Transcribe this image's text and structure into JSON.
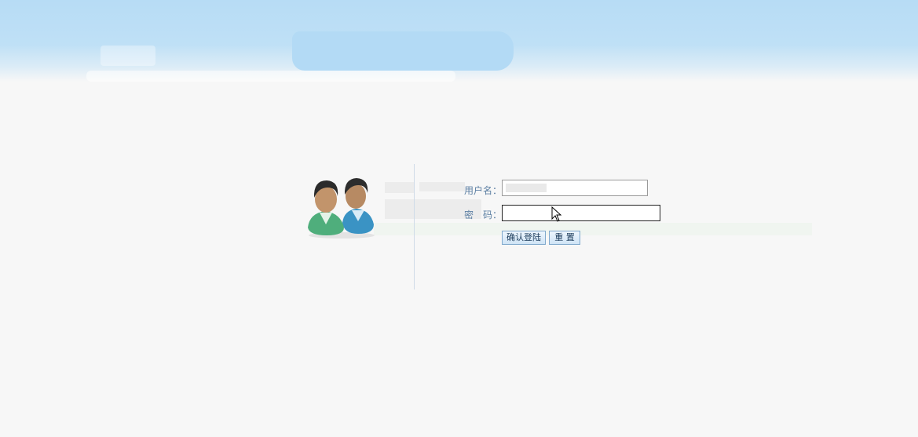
{
  "login": {
    "username_label": "用户名：",
    "password_label": "密　码：",
    "username_value": "",
    "password_value": "",
    "login_button": "确认登陆",
    "reset_button": "重 置"
  },
  "colors": {
    "banner": "#b7dcf5",
    "page_background": "#f7f7f7",
    "label_text": "#5c7fa3",
    "button_border": "#7fa8cc"
  },
  "icons": {
    "avatar": "users-icon",
    "cursor": "mouse-pointer-icon"
  }
}
